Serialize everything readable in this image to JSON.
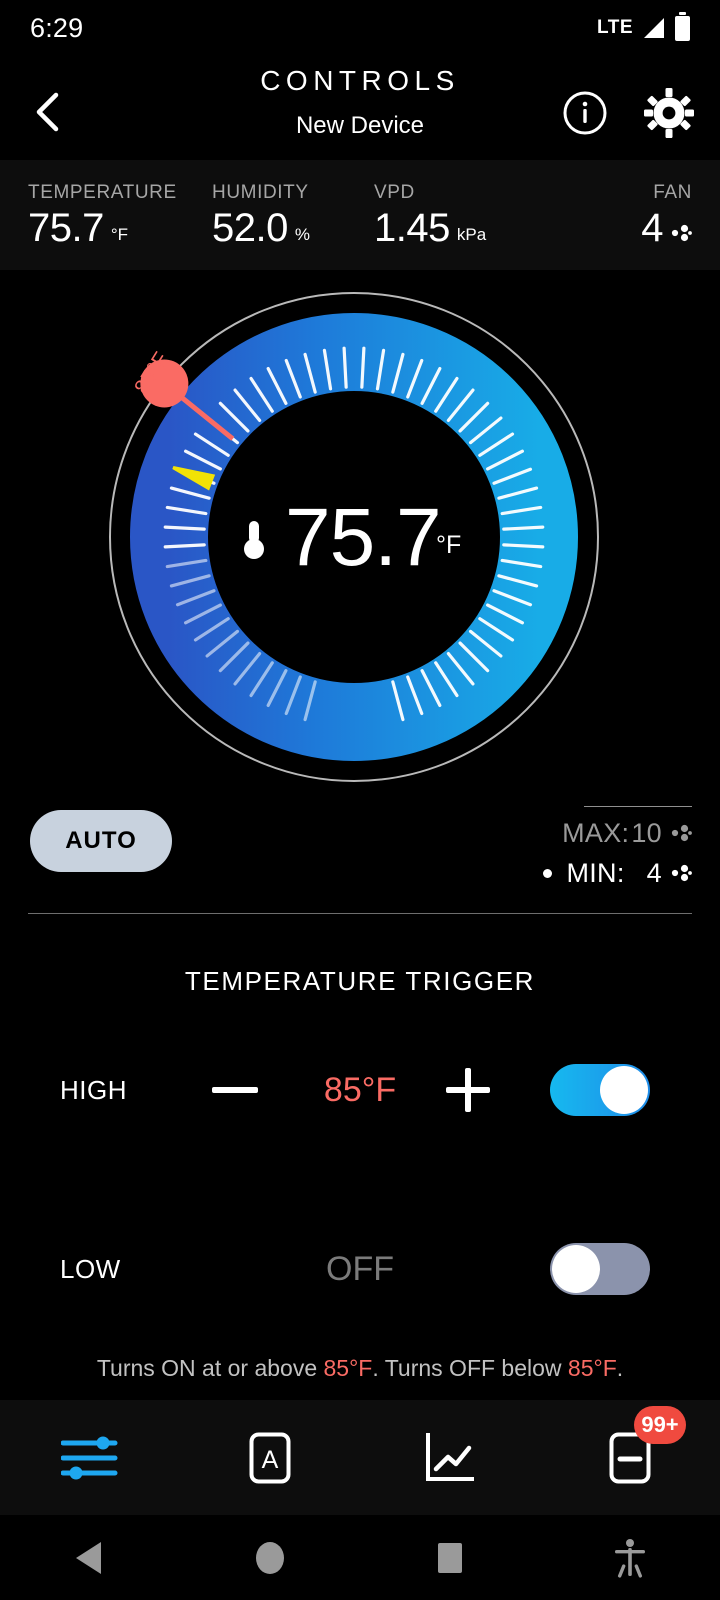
{
  "statusbar": {
    "time": "6:29",
    "network": "LTE",
    "signal_icon": "signal-triangle-icon",
    "battery_icon": "battery-icon"
  },
  "header": {
    "title": "CONTROLS",
    "subtitle": "New Device",
    "back_icon": "chevron-left-icon",
    "info_icon": "info-circle-icon",
    "settings_icon": "gear-icon"
  },
  "metrics": [
    {
      "label": "TEMPERATURE",
      "value": "75.7",
      "unit": "°F"
    },
    {
      "label": "HUMIDITY",
      "value": "52.0",
      "unit": "%"
    },
    {
      "label": "VPD",
      "value": "1.45",
      "unit": "kPa"
    },
    {
      "label": "FAN",
      "value": "4",
      "unit": "fan-icon"
    }
  ],
  "gauge": {
    "value": "75.7",
    "unit": "°F",
    "thermometer_icon": "thermometer-icon",
    "handle_label": "85°F",
    "handle_color": "#fa6b64",
    "ring_start_color": "#2a56c6",
    "ring_end_color": "#18ace7",
    "marker_color": "#f2e205",
    "outer_ring_color": "#b9b9b9"
  },
  "auto": {
    "label": "AUTO"
  },
  "minmax": {
    "max_label": "MAX:",
    "max_value": "10",
    "min_label": "MIN:",
    "min_value": "4",
    "fan_icon": "fan-icon"
  },
  "trigger": {
    "section_title": "TEMPERATURE TRIGGER",
    "high": {
      "label": "HIGH",
      "value": "85°F",
      "minus_icon": "minus-icon",
      "plus_icon": "plus-icon",
      "toggle": "on"
    },
    "low": {
      "label": "LOW",
      "value": "OFF",
      "toggle": "off"
    },
    "note_prefix": "Turns ON at or above ",
    "note_high": "85°F",
    "note_middle": ". Turns OFF below ",
    "note_low": "85°F",
    "note_suffix": "."
  },
  "tabbar": [
    {
      "name": "controls-tab",
      "icon": "sliders-icon",
      "active": true
    },
    {
      "name": "auto-tab",
      "icon": "a-box-icon",
      "active": false
    },
    {
      "name": "chart-tab",
      "icon": "line-chart-icon",
      "active": false
    },
    {
      "name": "notes-tab",
      "icon": "notes-icon",
      "active": false,
      "badge": "99+"
    }
  ],
  "navbar": [
    {
      "name": "android-back",
      "icon": "triangle-back-icon"
    },
    {
      "name": "android-home",
      "icon": "circle-home-icon"
    },
    {
      "name": "android-recents",
      "icon": "square-recents-icon"
    },
    {
      "name": "android-accessibility",
      "icon": "accessibility-icon"
    }
  ]
}
